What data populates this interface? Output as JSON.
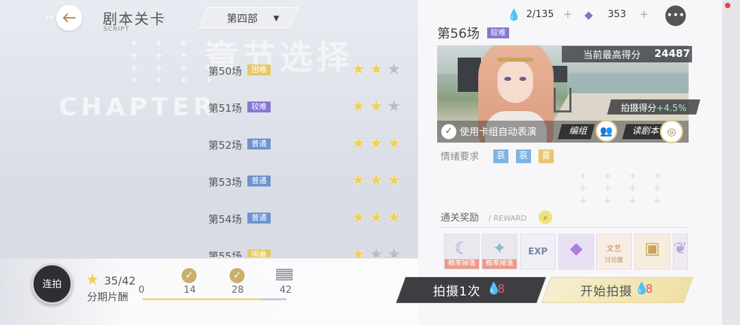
{
  "header": {
    "title": "剧本关卡",
    "subtitle": "SCRIPT",
    "part_selector": "第四部",
    "watermark_cn": "章节选择",
    "watermark_en": "CHAPTER"
  },
  "scenes": [
    {
      "name": "第50场",
      "difficulty": "困难",
      "stars": 2
    },
    {
      "name": "第51场",
      "difficulty": "较难",
      "stars": 2
    },
    {
      "name": "第52场",
      "difficulty": "普通",
      "stars": 3
    },
    {
      "name": "第53场",
      "difficulty": "普通",
      "stars": 3
    },
    {
      "name": "第54场",
      "difficulty": "普通",
      "stars": 3
    },
    {
      "name": "第55场",
      "difficulty": "困难",
      "stars": 1
    }
  ],
  "bottom": {
    "burst_label": "连拍",
    "star_count": "35/42",
    "pay_label": "分期片酬",
    "milestones": [
      "0",
      "14",
      "28",
      "42"
    ],
    "progress_fraction": 0.83
  },
  "currency": {
    "stamina": "2/135",
    "gems": "353"
  },
  "detail": {
    "scene_title": "第56场",
    "difficulty": "较难",
    "high_score_label": "当前最高得分",
    "high_score": "24487",
    "bonus_label": "拍摄得分",
    "bonus_value": "+4.5%",
    "auto_label": "使用卡组自动表演",
    "team_label": "编组",
    "read_label": "读剧本",
    "emotion_label": "情绪要求",
    "emotions": [
      "哀",
      "哀",
      "喜"
    ]
  },
  "rewards": {
    "label": "通关奖励",
    "label_en": "/ REWARD",
    "items": [
      {
        "icon": "moon-charm-icon",
        "tag": "概率掉落"
      },
      {
        "icon": "star-charm-icon",
        "tag": "概率掉落"
      },
      {
        "icon": "exp-badge-icon",
        "tag": ""
      },
      {
        "icon": "purple-gem-icon",
        "tag": ""
      },
      {
        "icon": "discussion-icon",
        "tag": ""
      },
      {
        "icon": "chest-icon",
        "tag": ""
      },
      {
        "icon": "wing-icon",
        "tag": ""
      }
    ],
    "item_texts": [
      "EXP",
      "文艺",
      "讨论度"
    ]
  },
  "actions": {
    "shoot_once": "拍摄1次",
    "shoot_cost": "8",
    "start": "开始拍摄",
    "start_cost": "8"
  },
  "colors": {
    "normal": "#6d93cf",
    "hard": "#8677d4",
    "very_hard": "#e8c860",
    "star": "#f2cf55"
  }
}
